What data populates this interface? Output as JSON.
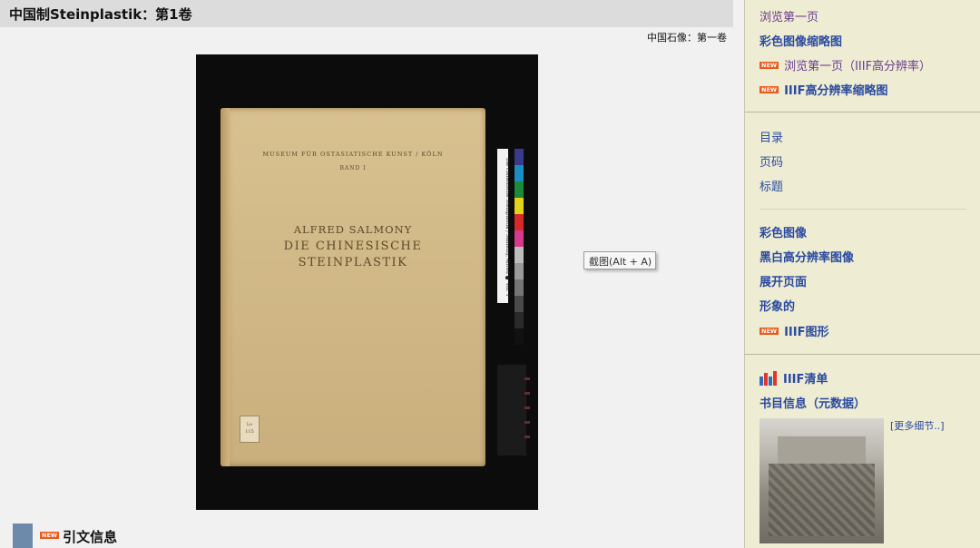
{
  "main": {
    "title": "中国制Steinplastik：第1卷",
    "subtitle": "中国石像：第一卷",
    "book": {
      "cover_line1": "MUSEUM FÜR OSTASIATISCHE KUNST / KÖLN",
      "cover_line2": "BAND I",
      "cover_line3": "ALFRED SALMONY",
      "cover_line4": "DIE CHINESISCHE",
      "cover_line5": "STEINPLASTIK",
      "label_line1": "Lo",
      "label_line2": "115",
      "ruler_text": "Die chinesische Steinplastik / Salmony, Alfred  ●  Vol. 1"
    },
    "tooltip": "截图(Alt + A)",
    "citation": {
      "badge": "NEW",
      "label": "引文信息"
    }
  },
  "sidebar": {
    "group1": [
      {
        "text": "浏览第一页",
        "badge": ""
      },
      {
        "text": "彩色图像缩略图",
        "badge": ""
      },
      {
        "text": "浏览第一页（IIIF高分辨率）",
        "badge": "NEW"
      },
      {
        "text": "IIIF高分辨率缩略图",
        "badge": "NEW"
      }
    ],
    "group2": [
      {
        "text": "目录"
      },
      {
        "text": "页码"
      },
      {
        "text": "标题"
      }
    ],
    "group3": [
      {
        "text": "彩色图像",
        "badge": ""
      },
      {
        "text": "黑白高分辨率图像",
        "badge": ""
      },
      {
        "text": "展开页面",
        "badge": ""
      },
      {
        "text": "形象的",
        "badge": ""
      },
      {
        "text": "IIIF图形",
        "badge": "NEW"
      }
    ],
    "group4": {
      "iiif_manifest": "IIIF清单",
      "bib_info": "书目信息（元数据）",
      "more_details": "[更多细节..]"
    }
  },
  "colors": {
    "link": "#2a4aa0",
    "visited_link": "#6a3c8f",
    "sidebar_bg": "#eeecd2",
    "new_badge": "#e85b1c",
    "swatches": [
      "#3a3a8c",
      "#1a8ec4",
      "#1d8a3a",
      "#e3d21a",
      "#d62a2a",
      "#d63a8e",
      "#bdbdbd",
      "#9a9a9a",
      "#757575",
      "#4a4a4a",
      "#2a2a2a",
      "#111111"
    ]
  },
  "icons": {
    "iiif": "iiif-logo-icon",
    "new": "new-badge-icon"
  }
}
